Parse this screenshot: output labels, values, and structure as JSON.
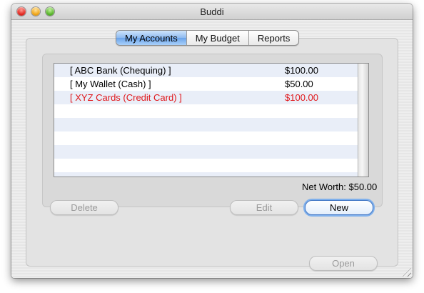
{
  "window": {
    "title": "Buddi"
  },
  "tabs": [
    {
      "label": "My Accounts",
      "active": true
    },
    {
      "label": "My Budget",
      "active": false
    },
    {
      "label": "Reports",
      "active": false
    }
  ],
  "accounts": [
    {
      "name": "[ ABC Bank (Chequing) ]",
      "amount": "$100.00",
      "negative": false
    },
    {
      "name": "[ My Wallet (Cash) ]",
      "amount": "$50.00",
      "negative": false
    },
    {
      "name": "[ XYZ Cards (Credit Card) ]",
      "amount": "$100.00",
      "negative": true
    }
  ],
  "summary": {
    "net_worth": "Net Worth: $50.00"
  },
  "buttons": {
    "delete": "Delete",
    "edit": "Edit",
    "new": "New",
    "open": "Open"
  },
  "colors": {
    "negative_text": "#e0161a",
    "tab_active": "#6aa3ea",
    "row_stripe": "#e9eef8"
  }
}
